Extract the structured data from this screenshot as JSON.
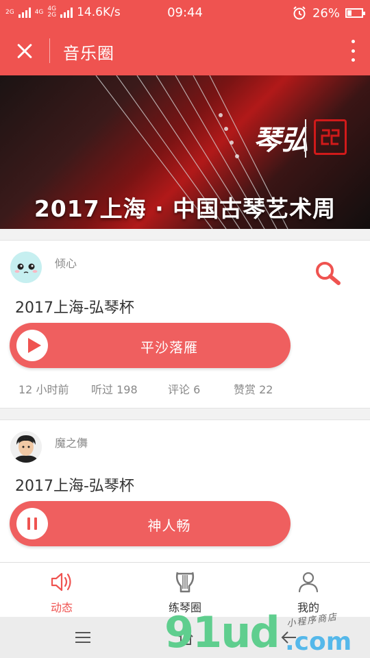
{
  "status_bar": {
    "net1": "2G",
    "net2": "4G",
    "net3": "4G",
    "net4": "2G",
    "speed": "14.6K/s",
    "time": "09:44",
    "battery": "26%"
  },
  "navbar": {
    "title": "音乐圈"
  },
  "banner": {
    "title": "2017上海 · 中国古琴艺术周",
    "brand": "琴弘"
  },
  "posts": [
    {
      "username": "倾心",
      "title": "2017上海-弘琴杯",
      "track": "平沙落雁",
      "state": "play",
      "time_ago": "12 小时前",
      "listens": "听过 198",
      "comments": "评论 6",
      "likes": "赞赏 22"
    },
    {
      "username": "魔之儛",
      "title": "2017上海-弘琴杯",
      "track": "神人畅",
      "state": "pause"
    }
  ],
  "tabbar": {
    "items": [
      {
        "label": "动态",
        "icon": "speaker-icon",
        "active": true
      },
      {
        "label": "练琴圈",
        "icon": "lyre-icon",
        "active": false
      },
      {
        "label": "我的",
        "icon": "user-icon",
        "active": false
      }
    ]
  },
  "watermark": {
    "main": "91ud",
    "domain": ".com",
    "sub": "小程序商店"
  },
  "colors": {
    "accent": "#ef5350",
    "player": "#ef5f5f"
  }
}
